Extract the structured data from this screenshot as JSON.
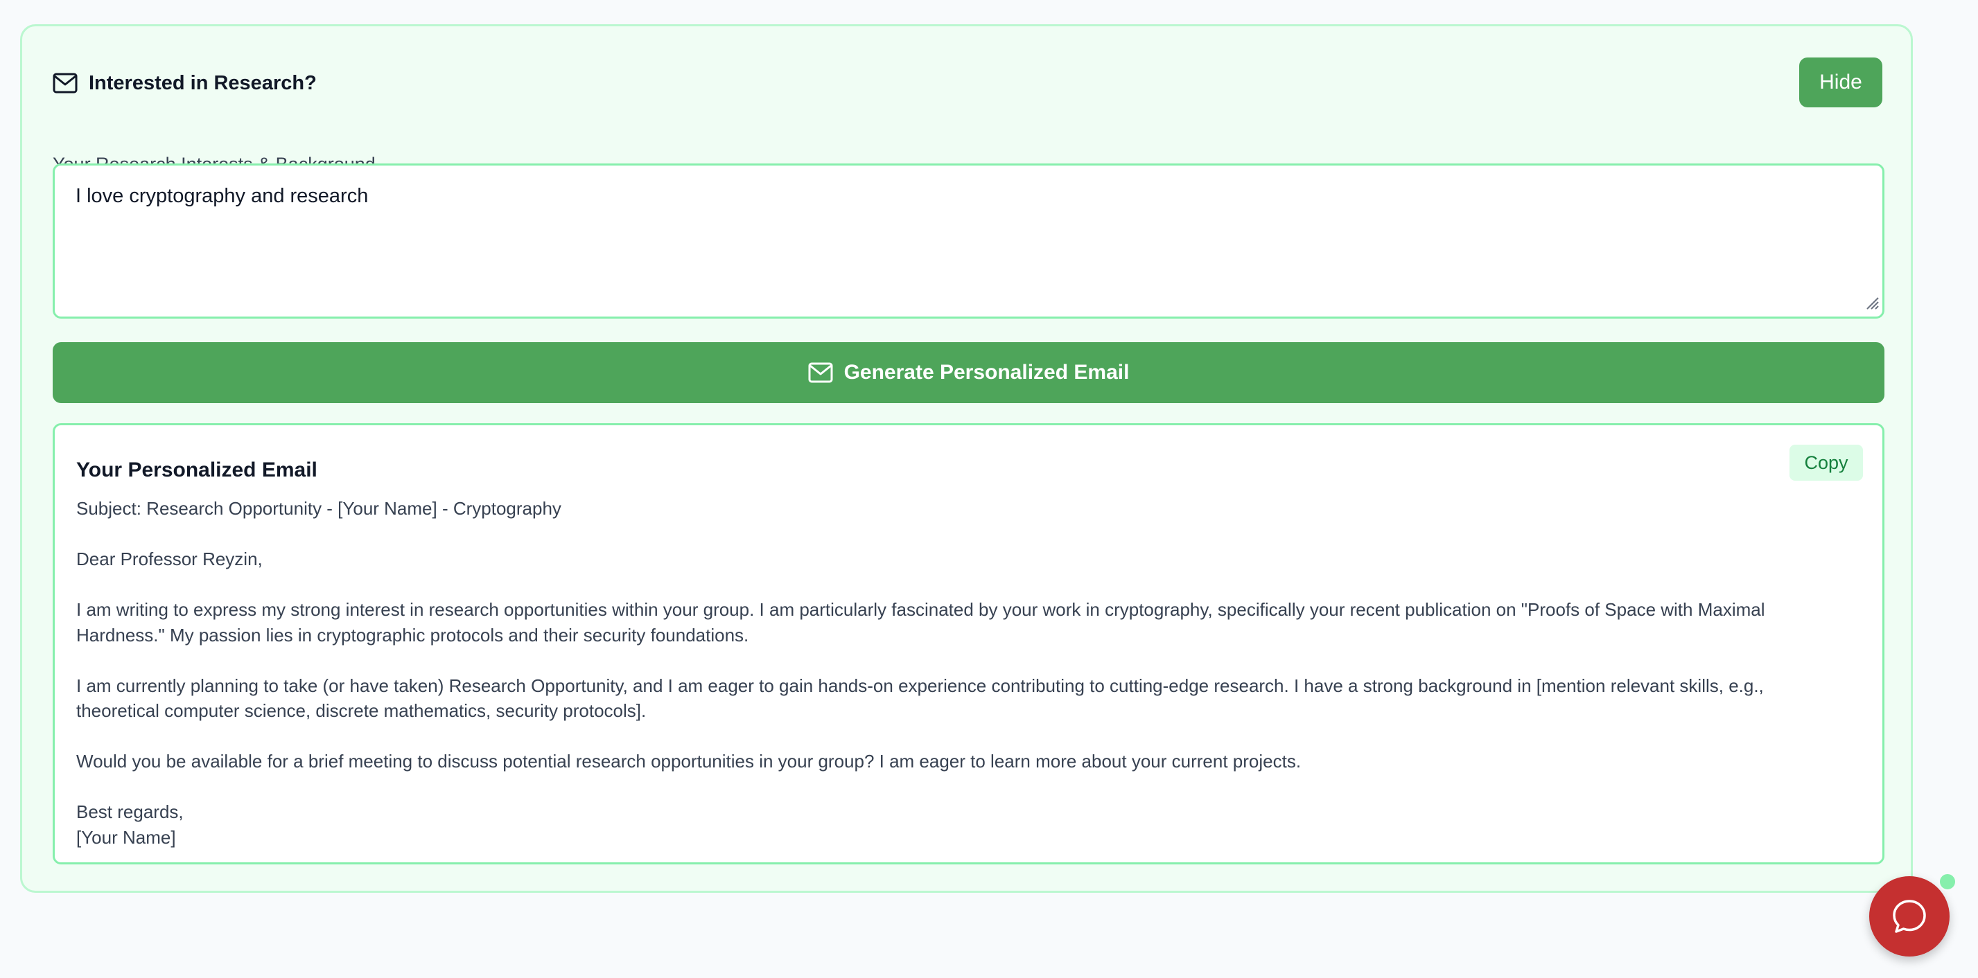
{
  "panel": {
    "title": "Interested in Research?",
    "icon": "mail-icon",
    "hide_label": "Hide"
  },
  "form": {
    "label": "Your Research Interests & Background",
    "value": "I love cryptography and research",
    "generate_label": "Generate Personalized Email",
    "generate_icon": "mail-icon"
  },
  "email": {
    "title": "Your Personalized Email",
    "copy_label": "Copy",
    "subject": "Subject: Research Opportunity - [Your Name] - Cryptography",
    "greeting": "Dear Professor Reyzin,",
    "paragraph_1": "I am writing to express my strong interest in research opportunities within your group. I am particularly fascinated by your work in cryptography, specifically your recent publication on \"Proofs of Space with Maximal Hardness.\" My passion lies in cryptographic protocols and their security foundations.",
    "paragraph_2": "I am currently planning to take (or have taken) Research Opportunity, and I am eager to gain hands-on experience contributing to cutting-edge research. I have a strong background in [mention relevant skills, e.g., theoretical computer science, discrete mathematics, security protocols].",
    "paragraph_3": "Would you be available for a brief meeting to discuss potential research opportunities in your group? I am eager to learn more about your current projects.",
    "closing": "Best regards,\n[Your Name]"
  },
  "chat": {
    "icon": "chat-bubble-icon",
    "color": "#c53030",
    "status_color": "#86efac"
  },
  "colors": {
    "accent": "#4ea55a",
    "panel_bg": "#f0fdf4",
    "border": "#86efac"
  }
}
